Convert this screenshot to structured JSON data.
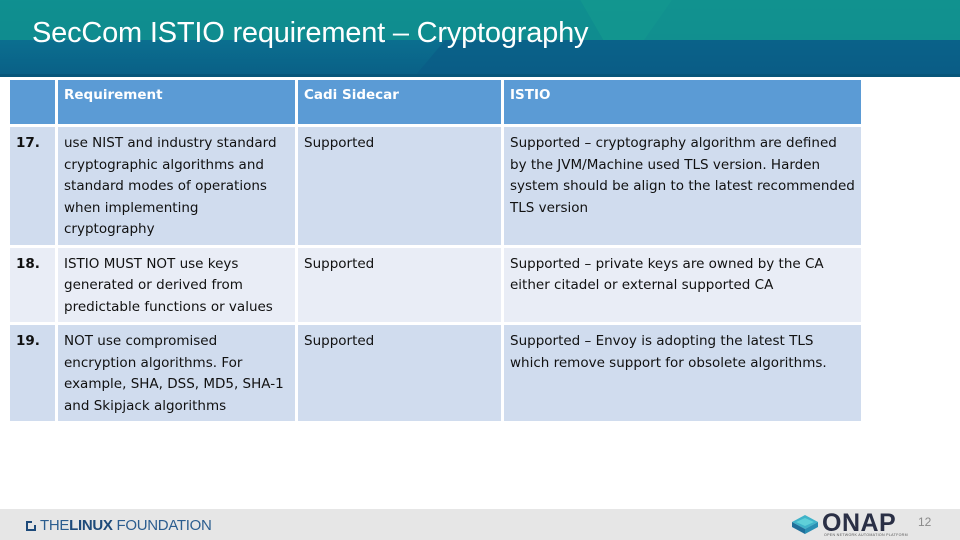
{
  "slide": {
    "title": "SecCom ISTIO requirement – Cryptography",
    "page_number": "12"
  },
  "table": {
    "headers": [
      "",
      "Requirement",
      "Cadi Sidecar",
      "ISTIO"
    ],
    "rows": [
      {
        "num": "17.",
        "requirement": "use NIST and industry standard cryptographic algorithms and standard modes of operations when implementing cryptography",
        "cadi_sidecar": "Supported",
        "istio": "Supported – cryptography algorithm are defined by the JVM/Machine used TLS version. Harden system should be align to the latest recommended TLS version"
      },
      {
        "num": "18.",
        "requirement": "ISTIO MUST NOT use keys generated or derived from predictable functions or values",
        "cadi_sidecar": "Supported",
        "istio": "Supported – private keys are owned by the CA either citadel or external supported CA"
      },
      {
        "num": "19.",
        "requirement": "NOT use compromised encryption algorithms. For example, SHA, DSS, MD5, SHA-1 and Skipjack algorithms",
        "cadi_sidecar": "Supported",
        "istio": "Supported – Envoy is adopting the latest TLS which remove support for obsolete algorithms."
      }
    ]
  },
  "footer": {
    "linux_foundation": {
      "the": "THE",
      "linux": "LINUX",
      "foundation": "FOUNDATION"
    },
    "onap": {
      "name": "ONAP",
      "subtitle": "OPEN NETWORK AUTOMATION PLATFORM"
    }
  },
  "colors": {
    "header_row": "#5b9bd5",
    "row_odd": "#d0dcee",
    "row_even": "#e9edf6",
    "banner": "#0b6e8f"
  }
}
